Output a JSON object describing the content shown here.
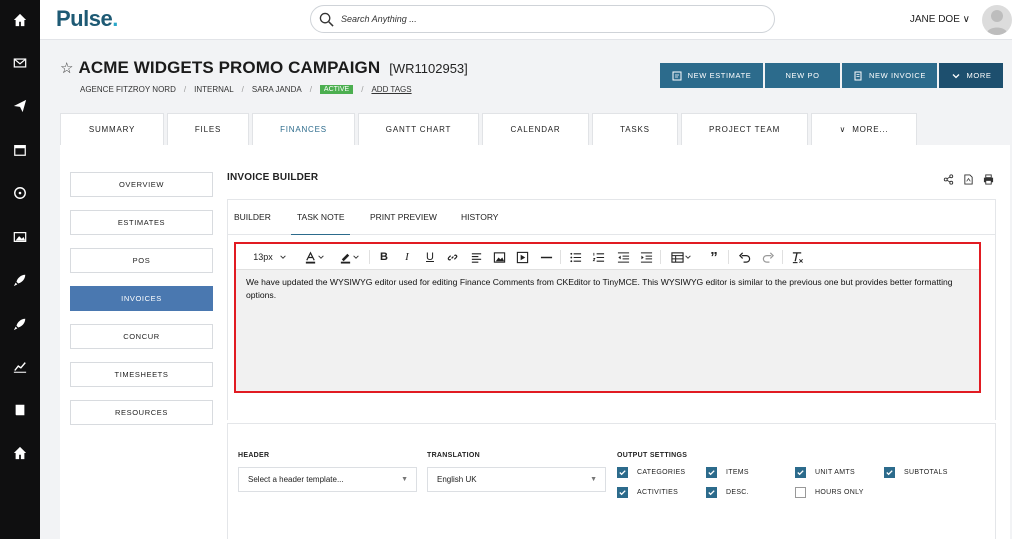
{
  "app": {
    "logo": "Pulse",
    "logo_dot": "."
  },
  "search": {
    "placeholder": "Search Anything ..."
  },
  "user": {
    "name": "JANE DOE"
  },
  "project": {
    "title": "ACME WIDGETS PROMO CAMPAIGN",
    "code": "[WR1102953]",
    "client": "AGENCE FITZROY NORD",
    "type": "INTERNAL",
    "owner": "SARA JANDA",
    "status": "ACTIVE",
    "add_tags": "ADD TAGS"
  },
  "actions": [
    {
      "label": "NEW ESTIMATE",
      "icon": "estimate-icon"
    },
    {
      "label": "NEW PO",
      "icon": "none"
    },
    {
      "label": "NEW INVOICE",
      "icon": "invoice-icon"
    },
    {
      "label": "MORE",
      "icon": "chevron-down-icon"
    }
  ],
  "tabs": [
    "SUMMARY",
    "FILES",
    "FINANCES",
    "GANTT CHART",
    "CALENDAR",
    "TASKS",
    "PROJECT TEAM",
    "MORE..."
  ],
  "active_tab": "FINANCES",
  "sidenav": [
    "OVERVIEW",
    "ESTIMATES",
    "POS",
    "INVOICES",
    "CONCUR",
    "TIMESHEETS",
    "RESOURCES"
  ],
  "active_sidenav": "INVOICES",
  "invoice_builder": {
    "title": "INVOICE BUILDER",
    "subtabs": [
      "BUILDER",
      "TASK NOTE",
      "PRINT PREVIEW",
      "HISTORY"
    ],
    "active_subtab": "TASK NOTE"
  },
  "editor": {
    "font_size": "13px",
    "content": "We have updated the WYSIWYG editor used for editing Finance Comments from CKEditor to TinyMCE. This WYSIWYG editor is similar to the previous one but provides better formatting options."
  },
  "settings": {
    "header_label": "HEADER",
    "header_placeholder": "Select a header template...",
    "translation_label": "TRANSLATION",
    "translation_value": "English UK",
    "output_label": "OUTPUT SETTINGS",
    "options": [
      {
        "label": "CATEGORIES",
        "checked": true
      },
      {
        "label": "ITEMS",
        "checked": true
      },
      {
        "label": "UNIT AMTS",
        "checked": true
      },
      {
        "label": "SUBTOTALS",
        "checked": true
      },
      {
        "label": "ACTIVITIES",
        "checked": true
      },
      {
        "label": "DESC.",
        "checked": true
      },
      {
        "label": "HOURS ONLY",
        "checked": false
      }
    ]
  },
  "colors": {
    "brand": "#1e5a74",
    "accent": "#2c6b8c",
    "active_nav": "#4a78b0",
    "status_green": "#4caf50",
    "highlight_red": "#e11b22"
  }
}
